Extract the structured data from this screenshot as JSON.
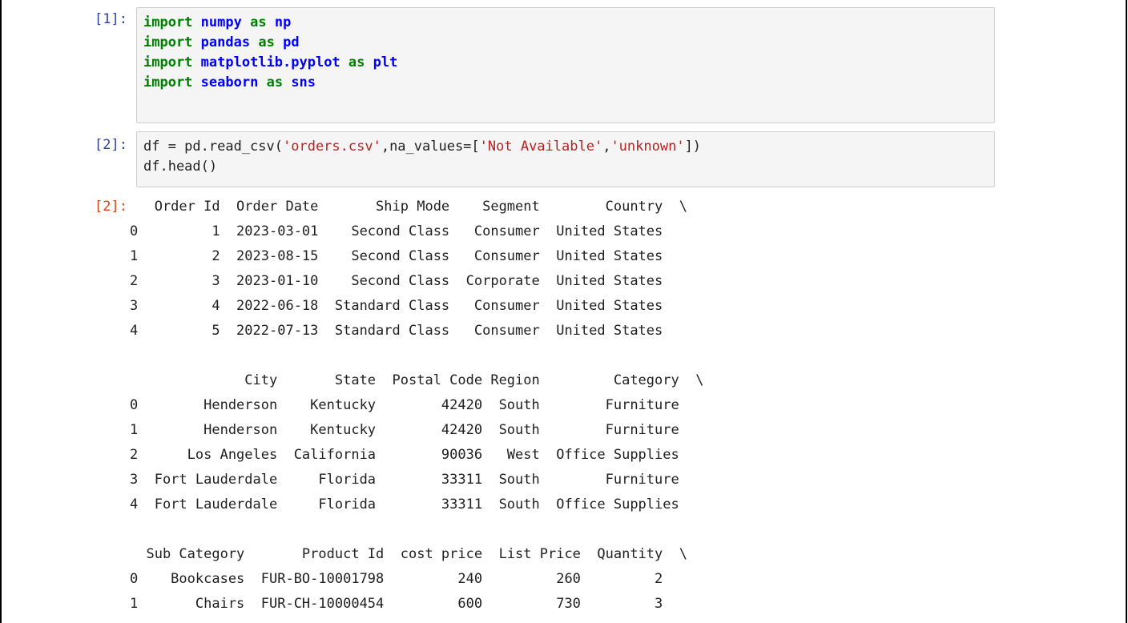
{
  "cells": [
    {
      "prompt": "[1]:",
      "lines": [
        [
          {
            "t": "import",
            "c": "kw"
          },
          {
            "t": " ",
            "c": "plain"
          },
          {
            "t": "numpy",
            "c": "mod"
          },
          {
            "t": " ",
            "c": "plain"
          },
          {
            "t": "as",
            "c": "kw"
          },
          {
            "t": " ",
            "c": "plain"
          },
          {
            "t": "np",
            "c": "mod"
          }
        ],
        [
          {
            "t": "import",
            "c": "kw"
          },
          {
            "t": " ",
            "c": "plain"
          },
          {
            "t": "pandas",
            "c": "mod"
          },
          {
            "t": " ",
            "c": "plain"
          },
          {
            "t": "as",
            "c": "kw"
          },
          {
            "t": " ",
            "c": "plain"
          },
          {
            "t": "pd",
            "c": "mod"
          }
        ],
        [
          {
            "t": "import",
            "c": "kw"
          },
          {
            "t": " ",
            "c": "plain"
          },
          {
            "t": "matplotlib.pyplot",
            "c": "mod"
          },
          {
            "t": " ",
            "c": "plain"
          },
          {
            "t": "as",
            "c": "kw"
          },
          {
            "t": " ",
            "c": "plain"
          },
          {
            "t": "plt",
            "c": "mod"
          }
        ],
        [
          {
            "t": "import",
            "c": "kw"
          },
          {
            "t": " ",
            "c": "plain"
          },
          {
            "t": "seaborn",
            "c": "mod"
          },
          {
            "t": " ",
            "c": "plain"
          },
          {
            "t": "as",
            "c": "kw"
          },
          {
            "t": " ",
            "c": "plain"
          },
          {
            "t": "sns",
            "c": "mod"
          }
        ]
      ]
    },
    {
      "prompt": "[2]:",
      "lines": [
        [
          {
            "t": "df = pd.read_csv(",
            "c": "plain"
          },
          {
            "t": "'orders.csv'",
            "c": "str"
          },
          {
            "t": ",na_values=[",
            "c": "plain"
          },
          {
            "t": "'Not Available'",
            "c": "str"
          },
          {
            "t": ",",
            "c": "plain"
          },
          {
            "t": "'unknown'",
            "c": "str"
          },
          {
            "t": "])",
            "c": "plain"
          }
        ],
        [
          {
            "t": "df.head()",
            "c": "plain"
          }
        ]
      ]
    }
  ],
  "output": {
    "prompt": "[2]:",
    "lines": [
      "   Order Id  Order Date       Ship Mode    Segment        Country  \\",
      "0         1  2023-03-01    Second Class   Consumer  United States",
      "1         2  2023-08-15    Second Class   Consumer  United States",
      "2         3  2023-01-10    Second Class  Corporate  United States",
      "3         4  2022-06-18  Standard Class   Consumer  United States",
      "4         5  2022-07-13  Standard Class   Consumer  United States",
      "",
      "              City       State  Postal Code Region         Category  \\",
      "0        Henderson    Kentucky        42420  South        Furniture",
      "1        Henderson    Kentucky        42420  South        Furniture",
      "2      Los Angeles  California        90036   West  Office Supplies",
      "3  Fort Lauderdale     Florida        33311  South        Furniture",
      "4  Fort Lauderdale     Florida        33311  South  Office Supplies",
      "",
      "  Sub Category       Product Id  cost price  List Price  Quantity  \\",
      "0    Bookcases  FUR-BO-10001798         240         260         2",
      "1       Chairs  FUR-CH-10000454         600         730         3"
    ]
  }
}
